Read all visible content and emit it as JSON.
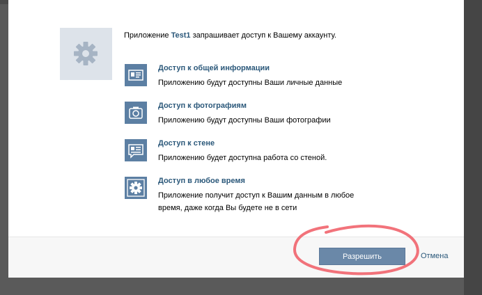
{
  "dialog": {
    "intro_prefix": "Приложение",
    "app_name": "Test1",
    "intro_suffix": "запрашивает доступ к Вашему аккаунту."
  },
  "permissions": [
    {
      "icon": "profile-card-icon",
      "title": "Доступ к общей информации",
      "description": "Приложению будут доступны Ваши личные данные"
    },
    {
      "icon": "camera-icon",
      "title": "Доступ к фотографиям",
      "description": "Приложению будут доступны Ваши фотографии"
    },
    {
      "icon": "wall-message-icon",
      "title": "Доступ к стене",
      "description": "Приложению будет доступна работа со стеной."
    },
    {
      "icon": "gear-icon",
      "title": "Доступ в любое время",
      "description": "Приложение получит доступ к Вашим данным в любое время, даже когда Вы будете не в сети"
    }
  ],
  "footer": {
    "allow_label": "Разрешить",
    "cancel_label": "Отмена"
  },
  "colors": {
    "link": "#2b587a",
    "icon_bg": "#5c7fa3",
    "button_bg": "#6a88a8",
    "annotation": "#f05a64"
  }
}
